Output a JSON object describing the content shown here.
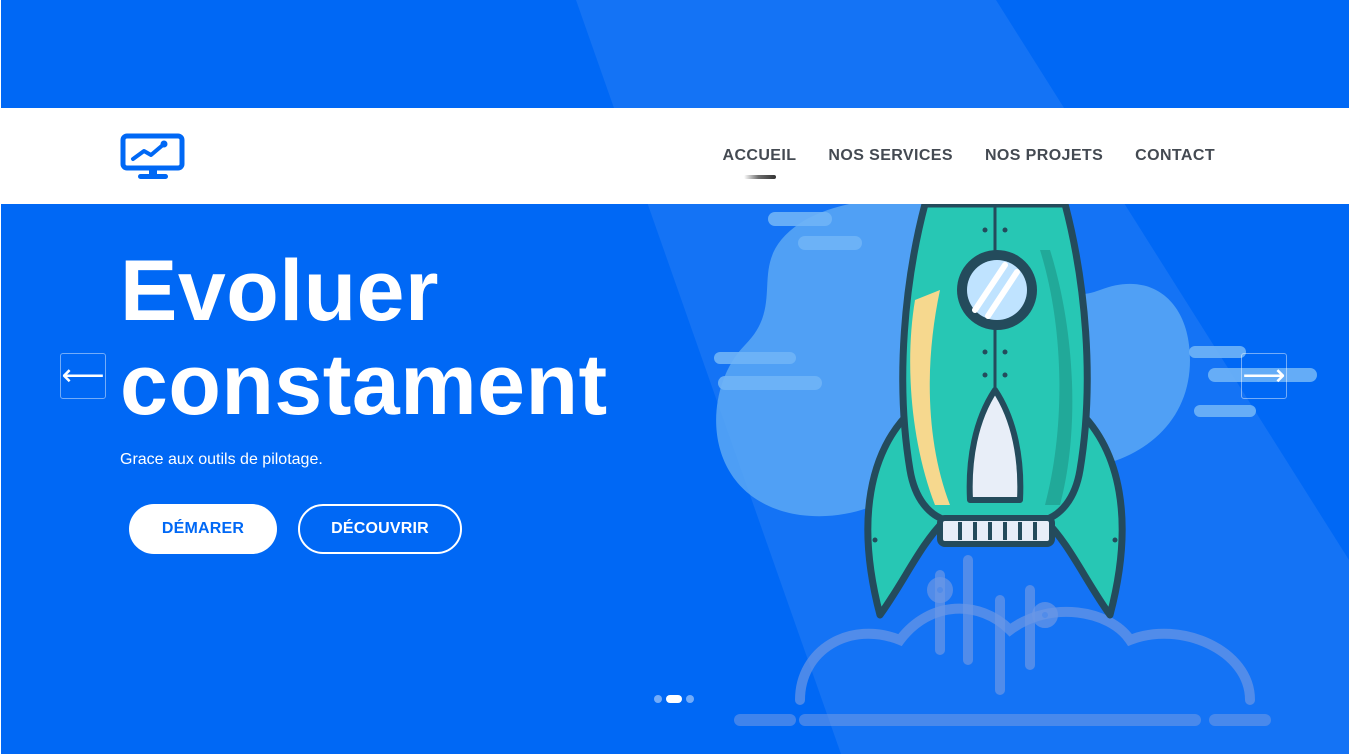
{
  "brand": {
    "logo_icon": "monitor-chart-icon",
    "color": "#0068f5"
  },
  "nav": {
    "items": [
      {
        "label": "ACCUEIL",
        "active": true
      },
      {
        "label": "NOS SERVICES",
        "active": false
      },
      {
        "label": "NOS PROJETS",
        "active": false
      },
      {
        "label": "CONTACT",
        "active": false
      }
    ]
  },
  "hero": {
    "title_line1": "Evoluer",
    "title_line2": "constament",
    "subtitle": "Grace aux outils de pilotage.",
    "primary_button": "DÉMARER",
    "secondary_button": "DÉCOUVRIR",
    "illustration_icon": "rocket-illustration"
  },
  "slider": {
    "prev_icon": "arrow-left-icon",
    "next_icon": "arrow-right-icon",
    "prev_glyph": "⟵",
    "next_glyph": "⟶",
    "slide_count": 3,
    "active_slide": 2
  },
  "colors": {
    "background": "#0068f5",
    "text": "#ffffff",
    "nav_text": "#444a52"
  }
}
